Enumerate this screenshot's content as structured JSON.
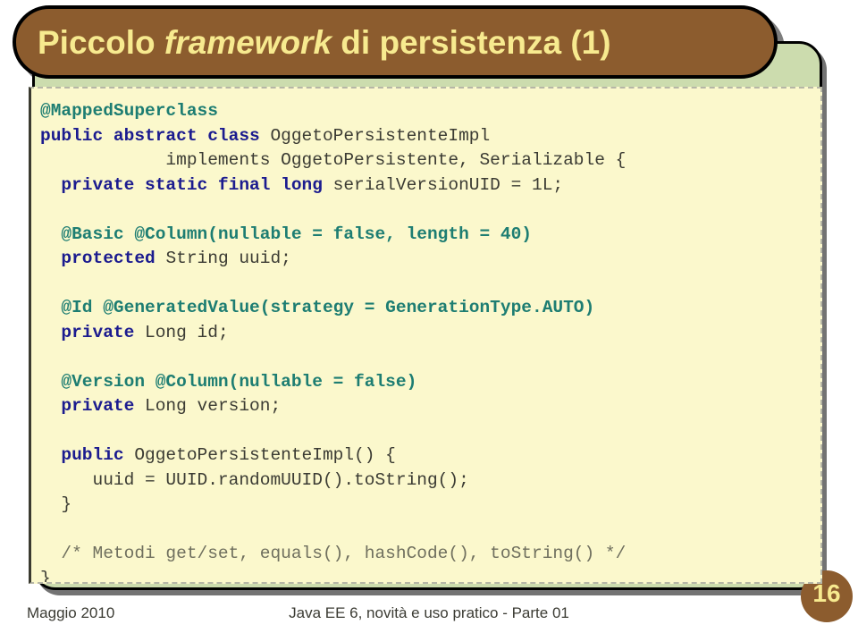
{
  "slide": {
    "title_prefix": "Piccolo ",
    "title_emphasis": "framework",
    "title_suffix": " di persistenza (1)",
    "title_full": "Piccolo framework di persistenza (1)",
    "number": "16"
  },
  "colors": {
    "title_bar": "#8c5c2e",
    "title_text": "#f7ea8f",
    "panel": "#ccdcae",
    "code_background": "#fbf8cc",
    "annotation": "#1d7d72",
    "keyword": "#1b1b8f",
    "plain": "#3b3b33",
    "comment": "#6f6f5e"
  },
  "code": {
    "language": "java",
    "lines": [
      [
        {
          "t": "@MappedSuperclass",
          "c": "ann"
        }
      ],
      [
        {
          "t": "public abstract class ",
          "c": "kw"
        },
        {
          "t": "OggetoPersistenteImpl",
          "c": "txt"
        }
      ],
      [
        {
          "t": "            implements OggetoPersistente, Serializable {",
          "c": "txt"
        }
      ],
      [
        {
          "t": "  private static final long ",
          "c": "kw"
        },
        {
          "t": "serialVersionUID = 1L;",
          "c": "txt"
        }
      ],
      [
        {
          "t": "",
          "c": "txt"
        }
      ],
      [
        {
          "t": "  @Basic @Column(nullable = false, length = 40)",
          "c": "ann"
        }
      ],
      [
        {
          "t": "  protected ",
          "c": "kw"
        },
        {
          "t": "String uuid;",
          "c": "txt"
        }
      ],
      [
        {
          "t": "",
          "c": "txt"
        }
      ],
      [
        {
          "t": "  @Id @GeneratedValue(strategy = GenerationType.AUTO)",
          "c": "ann"
        }
      ],
      [
        {
          "t": "  private ",
          "c": "kw"
        },
        {
          "t": "Long id;",
          "c": "txt"
        }
      ],
      [
        {
          "t": "",
          "c": "txt"
        }
      ],
      [
        {
          "t": "  @Version @Column(nullable = false)",
          "c": "ann"
        }
      ],
      [
        {
          "t": "  private ",
          "c": "kw"
        },
        {
          "t": "Long version;",
          "c": "txt"
        }
      ],
      [
        {
          "t": "",
          "c": "txt"
        }
      ],
      [
        {
          "t": "  public ",
          "c": "kw"
        },
        {
          "t": "OggetoPersistenteImpl() {",
          "c": "txt"
        }
      ],
      [
        {
          "t": "     uuid = UUID.randomUUID().toString();",
          "c": "txt"
        }
      ],
      [
        {
          "t": "  }",
          "c": "txt"
        }
      ],
      [
        {
          "t": "",
          "c": "txt"
        }
      ],
      [
        {
          "t": "  /* Metodi get/set, equals(), hashCode(), toString() */",
          "c": "cmt"
        }
      ],
      [
        {
          "t": "}",
          "c": "txt"
        }
      ]
    ]
  },
  "footer": {
    "date": "Maggio 2010",
    "subject": "Java EE 6, novità e uso pratico - Parte 01"
  }
}
